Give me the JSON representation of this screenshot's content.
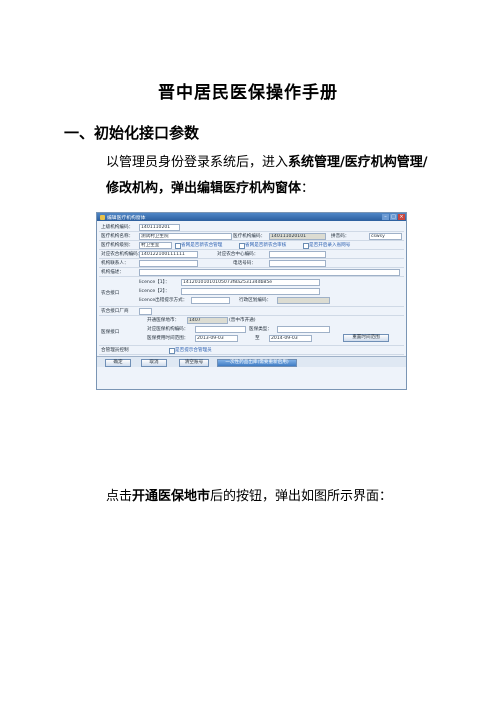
{
  "document": {
    "title": "晋中居民医保操作手册",
    "section_heading": "一、初始化接口参数",
    "para1_pre": "以管理员身份登录系统后，进入",
    "para1_bold1": "系统管理/医疗机构管理/修改机构，弹出编辑医疗机构窗体",
    "para1_post": "：",
    "para2_pre": "点击",
    "para2_bold": "开通医保地市",
    "para2_post": "后的按钮，弹出如图所示界面："
  },
  "window": {
    "title": "编辑医疗机构窗体",
    "fields": {
      "parent_code_label": "上级机构编码：",
      "parent_code_value": "1401110201",
      "org_name_label": "医疗机构名称：",
      "org_name_value": "测试村卫生院",
      "org_code_label": "医疗机构编码：",
      "org_code_value": "140111020101",
      "pinyin_label": "拼音码：",
      "pinyin_value": "cswsy",
      "org_type_label": "医疗机构级别：",
      "org_type_value": "村卫生室",
      "nhis_code_label": "对应农合机构编码：",
      "nhis_code_value": "140122100111111",
      "nhis_center_label": "对应农合中心编码：",
      "legal_person_label": "机构联系人：",
      "phone_label": "电话号码：",
      "note_label": "机构描述：",
      "opt1": "省网是否新农合管理",
      "opt2": "省网是否新农合审核",
      "opt3": "是否开启录入省网号"
    },
    "nhis_section": {
      "label": "农合接口",
      "licence1_label": "licence【1】：",
      "licence1_value": "14120101010105073f8a253134db85e",
      "licence2_label": "licence【2】：",
      "licence_mode_label": "licence出错提示方式：",
      "region_label": "行政区划编码："
    },
    "vendor_label": "农合接口厂商",
    "insurance_section": {
      "label": "医保接口",
      "city_label": "开通医保地市：",
      "city_value": "1407",
      "city_suffix": "(晋中市开通)",
      "org_code_label": "对应医保机构编码：",
      "level_label": "医保类型：",
      "date_label": "医保费用时间范围：",
      "date_from": "2013-09-03",
      "date_to": "2014-09-03",
      "date_sep": "至",
      "reset_button": "重置时间范围"
    },
    "manage_label": "合管理员控制",
    "manage_opt": "是否提示合管理员",
    "buttons": {
      "confirm": "确定",
      "cancel": "取消",
      "clear": "清空账号",
      "batch": "一次性药品出库(需要重新启用)"
    }
  }
}
